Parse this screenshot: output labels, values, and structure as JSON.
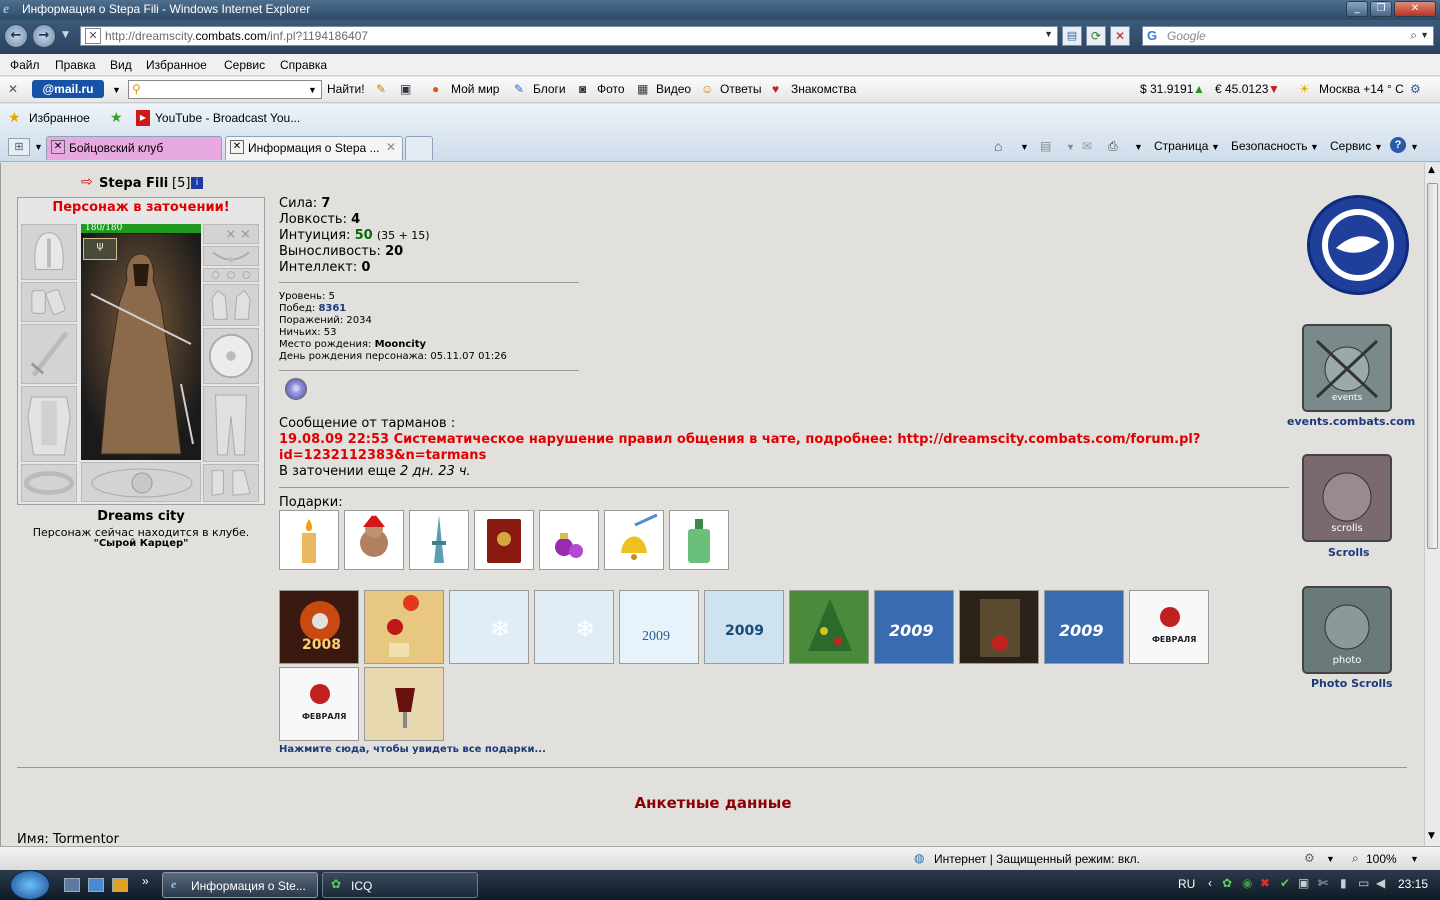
{
  "window": {
    "title": "Информация о Stepa Fili - Windows Internet Explorer"
  },
  "address": {
    "prefix": "http://dreamscity.",
    "domain": "combats.com",
    "suffix": "/inf.pl?1194186407"
  },
  "search": {
    "placeholder": "Google"
  },
  "menu": [
    "Файл",
    "Правка",
    "Вид",
    "Избранное",
    "Сервис",
    "Справка"
  ],
  "mailbar": {
    "logo": "@mail.ru",
    "find": "Найти!",
    "items": [
      "Мой мир",
      "Блоги",
      "Фото",
      "Видео",
      "Ответы",
      "Знакомства"
    ],
    "usd": "$ 31.9191",
    "eur": "€ 45.0123",
    "weather": "Москва +14 ° C"
  },
  "favorites": {
    "label": "Избранное",
    "youtube": "YouTube - Broadcast You..."
  },
  "tabs": [
    {
      "label": "Бойцовский клуб"
    },
    {
      "label": "Информация о Stepa ..."
    }
  ],
  "commandbar": {
    "page": "Страница",
    "security": "Безопасность",
    "service": "Сервис"
  },
  "character": {
    "name": "Stepa Fili",
    "level_tag": "[5]",
    "prison": "Персонаж в заточении!",
    "hp": "180/180",
    "club": "Dreams city",
    "location_text": "Персонаж сейчас находится в клубе.",
    "location_room": "\"Сырой Карцер\""
  },
  "stats": [
    {
      "label": "Сила:",
      "value": "7",
      "extra": ""
    },
    {
      "label": "Ловкость:",
      "value": "4",
      "extra": ""
    },
    {
      "label": "Интуиция:",
      "value": "50",
      "extra": "(35 + 15)"
    },
    {
      "label": "Выносливость:",
      "value": "20",
      "extra": ""
    },
    {
      "label": "Интеллект:",
      "value": "0",
      "extra": ""
    }
  ],
  "info": {
    "level": "Уровень: 5",
    "wins_label": "Побед:",
    "wins": "8361",
    "losses": "Поражений: 2034",
    "draws": "Ничьих: 53",
    "birthplace_label": "Место рождения:",
    "birthplace": "Mooncity",
    "birthday": "День рождения персонажа: 05.11.07 01:26"
  },
  "message": {
    "header": "Сообщение от тарманов :",
    "text": "19.08.09 22:53 Систематическое нарушение правил общения в чате, подробнее: http://dreamscity.combats.com/forum.pl?id=1232112383&n=tarmans",
    "prison_label": "В заточении еще ",
    "prison_time": "2 дн. 23 ч."
  },
  "gifts": {
    "label": "Подарки:",
    "more": "Нажмите сюда, чтобы увидеть все подарки..."
  },
  "right_links": {
    "events": "events.combats.com",
    "events_caption": "events",
    "scrolls": "Scrolls",
    "scrolls_caption": "scrolls",
    "photo": "Photo Scrolls",
    "photo_caption": "photo"
  },
  "cards_text": {
    "c1": "2008",
    "c5": "2009",
    "c6": "2009",
    "c8": "2009",
    "c10": "2009",
    "c11": "ФЕВРАЛЯ",
    "c12": "ФЕВРАЛЯ"
  },
  "profile": {
    "title": "Анкетные данные",
    "name_label": "Имя:",
    "name": "Tormentor"
  },
  "status": {
    "zone": "Интернет | Защищенный режим: вкл.",
    "zoom": "100%"
  },
  "taskbar": {
    "items": [
      "Информация о Ste...",
      "ICQ"
    ],
    "lang": "RU",
    "time": "23:15"
  },
  "colors": {
    "prison_red": "#e00000",
    "win_blue": "#1a3a7a",
    "profile_title": "#8b0000"
  }
}
